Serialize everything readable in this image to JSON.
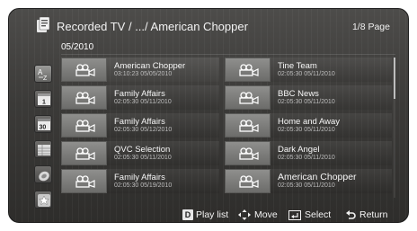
{
  "header": {
    "title": "Recorded TV / .../ American Chopper",
    "page": "1/8 Page",
    "icon": "folder-record-icon"
  },
  "date_label": "05/2010",
  "sidebar": {
    "buttons": [
      {
        "name": "sort-title-icon",
        "label": "A-Z"
      },
      {
        "name": "sort-channel-icon",
        "label": "1"
      },
      {
        "name": "sort-date-icon",
        "label": "30"
      },
      {
        "name": "sort-schedule-icon",
        "label": ""
      },
      {
        "name": "sort-genre-icon",
        "label": ""
      },
      {
        "name": "sort-favorite-icon",
        "label": ""
      }
    ]
  },
  "recordings_left": [
    {
      "title": "American Chopper",
      "meta": "03:10:23  05/05/2010"
    },
    {
      "title": "Family Affairs",
      "meta": "02:05:30  05/11/2010"
    },
    {
      "title": "Family Affairs",
      "meta": "02:05:30  05/12/2010"
    },
    {
      "title": "QVC Selection",
      "meta": "02:05:30  05/11/2010"
    },
    {
      "title": "Family Affairs",
      "meta": "02:05:30  05/19/2010"
    }
  ],
  "recordings_right": [
    {
      "title": "Tine Team",
      "meta": "02:05:30  05/11/2010"
    },
    {
      "title": "BBC News",
      "meta": "02:05:30  05/11/2010"
    },
    {
      "title": "Home and Away",
      "meta": "02:05:30  05/11/2010"
    },
    {
      "title": "Dark Angel",
      "meta": "02:05:30  05/11/2010"
    },
    {
      "title": "American Chopper",
      "meta": "02:05:30  05/11/2010"
    }
  ],
  "footer": {
    "playlist_key": "D",
    "playlist": "Play list",
    "move": "Move",
    "select": "Select",
    "return": "Return"
  },
  "colors": {
    "background": "#3b3a38",
    "thumbnail": "#7d7d7b",
    "text": "#f7f7f7",
    "meta_text": "#bdbdbd"
  }
}
